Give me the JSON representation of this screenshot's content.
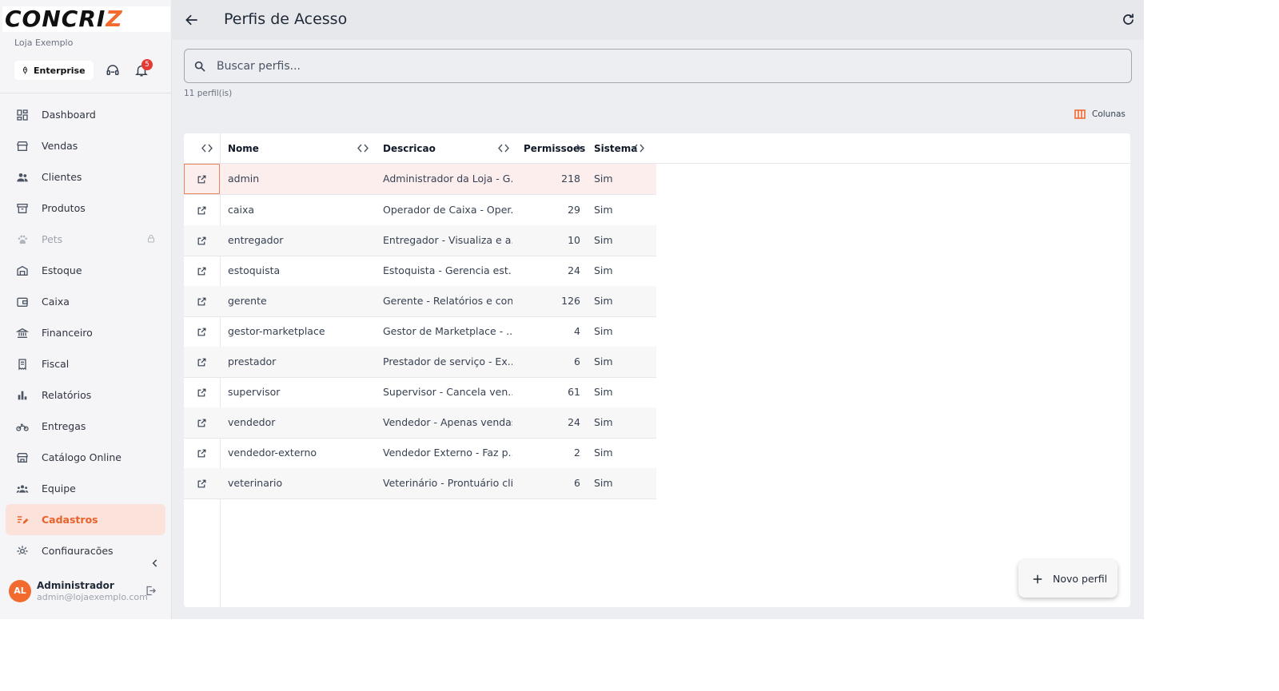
{
  "brand": {
    "logo_text_a": "CONCRI",
    "logo_text_b": "Z",
    "store_name": "Loja Exemplo",
    "plan": "Enterprise",
    "notification_count": "5",
    "accent_color": "#f26a2e"
  },
  "sidebar": {
    "items": [
      {
        "label": "Dashboard",
        "icon": "dashboard-icon"
      },
      {
        "label": "Vendas",
        "icon": "store-icon"
      },
      {
        "label": "Clientes",
        "icon": "people-icon"
      },
      {
        "label": "Produtos",
        "icon": "archive-icon"
      },
      {
        "label": "Pets",
        "icon": "paw-icon",
        "locked": true
      },
      {
        "label": "Estoque",
        "icon": "warehouse-icon"
      },
      {
        "label": "Caixa",
        "icon": "wallet-icon"
      },
      {
        "label": "Financeiro",
        "icon": "bank-icon"
      },
      {
        "label": "Fiscal",
        "icon": "receipt-icon"
      },
      {
        "label": "Relatórios",
        "icon": "bar-chart-icon"
      },
      {
        "label": "Entregas",
        "icon": "motorcycle-icon"
      },
      {
        "label": "Catálogo Online",
        "icon": "storefront-icon"
      },
      {
        "label": "Equipe",
        "icon": "groups-icon"
      },
      {
        "label": "Cadastros",
        "icon": "list-edit-icon",
        "active": true
      },
      {
        "label": "Configurações",
        "icon": "settings-icon"
      }
    ],
    "user": {
      "initials": "AL",
      "name": "Administrador",
      "email": "admin@lojaexemplo.com"
    }
  },
  "header": {
    "title": "Perfis de Acesso"
  },
  "search": {
    "placeholder": "Buscar perfis...",
    "value": ""
  },
  "results_count": "11 perfil(is)",
  "columns_button": "Colunas",
  "table": {
    "headers": {
      "nome": "Nome",
      "descricao": "Descricao",
      "permissoes": "Permissoes",
      "sistema": "Sistema"
    },
    "rows": [
      {
        "nome": "admin",
        "descricao": "Administrador da Loja - G...",
        "permissoes": "218",
        "sistema": "Sim"
      },
      {
        "nome": "caixa",
        "descricao": "Operador de Caixa - Oper...",
        "permissoes": "29",
        "sistema": "Sim"
      },
      {
        "nome": "entregador",
        "descricao": "Entregador - Visualiza e a...",
        "permissoes": "10",
        "sistema": "Sim"
      },
      {
        "nome": "estoquista",
        "descricao": "Estoquista - Gerencia est...",
        "permissoes": "24",
        "sistema": "Sim"
      },
      {
        "nome": "gerente",
        "descricao": "Gerente - Relatórios e con...",
        "permissoes": "126",
        "sistema": "Sim"
      },
      {
        "nome": "gestor-marketplace",
        "descricao": "Gestor de Marketplace - ...",
        "permissoes": "4",
        "sistema": "Sim"
      },
      {
        "nome": "prestador",
        "descricao": "Prestador de serviço - Ex...",
        "permissoes": "6",
        "sistema": "Sim"
      },
      {
        "nome": "supervisor",
        "descricao": "Supervisor - Cancela ven...",
        "permissoes": "61",
        "sistema": "Sim"
      },
      {
        "nome": "vendedor",
        "descricao": "Vendedor - Apenas vendas",
        "permissoes": "24",
        "sistema": "Sim"
      },
      {
        "nome": "vendedor-externo",
        "descricao": "Vendedor Externo - Faz p...",
        "permissoes": "2",
        "sistema": "Sim"
      },
      {
        "nome": "veterinario",
        "descricao": "Veterinário - Prontuário clí...",
        "permissoes": "6",
        "sistema": "Sim"
      }
    ]
  },
  "fab_label": "Novo perfil"
}
